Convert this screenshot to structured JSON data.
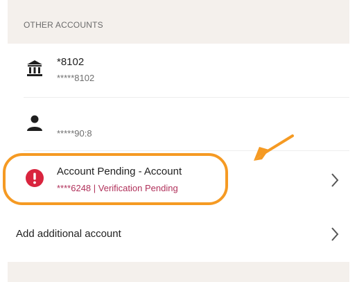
{
  "section": {
    "header": "OTHER ACCOUNTS"
  },
  "accounts": [
    {
      "icon": "bank-icon",
      "title": "*8102",
      "subtitle": "*****8102"
    },
    {
      "icon": "person-icon",
      "title": "",
      "subtitle": "*****90:8"
    },
    {
      "icon": "alert-icon",
      "title": "Account Pending - Account",
      "subtitle": "****6248 | Verification Pending"
    }
  ],
  "actions": {
    "add_account": "Add additional account"
  },
  "colors": {
    "background": "#ffffff",
    "section_band": "#f4f0ec",
    "alert_red": "#d9243e",
    "pending_text": "#b0305a",
    "highlight_orange": "#f59a23"
  }
}
